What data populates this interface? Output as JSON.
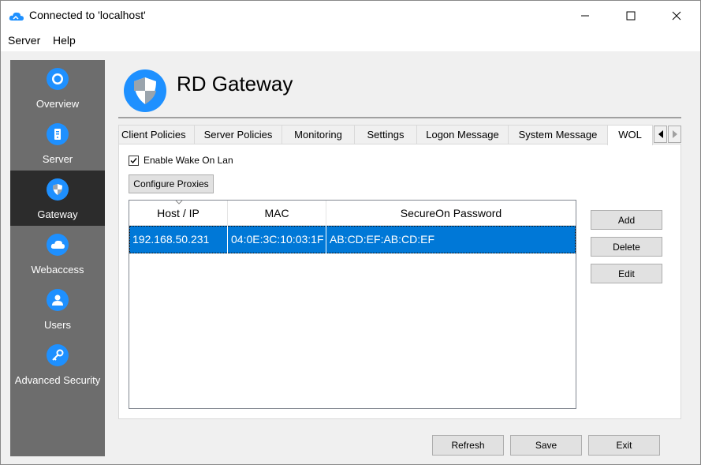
{
  "window": {
    "title": "Connected to 'localhost'"
  },
  "menu": [
    "Server",
    "Help"
  ],
  "sidebar": {
    "items": [
      {
        "label": "Overview",
        "icon": "overview-icon",
        "active": false
      },
      {
        "label": "Server",
        "icon": "server-icon",
        "active": false
      },
      {
        "label": "Gateway",
        "icon": "shield-icon",
        "active": true
      },
      {
        "label": "Webaccess",
        "icon": "cloud-icon",
        "active": false
      },
      {
        "label": "Users",
        "icon": "users-icon",
        "active": false
      },
      {
        "label": "Advanced Security",
        "icon": "key-icon",
        "active": false
      }
    ]
  },
  "header": {
    "title": "RD Gateway",
    "icon": "shield-icon"
  },
  "tabs": [
    {
      "label": "Client Policies"
    },
    {
      "label": "Server Policies"
    },
    {
      "label": "Monitoring"
    },
    {
      "label": "Settings"
    },
    {
      "label": "Logon Message"
    },
    {
      "label": "System Message"
    },
    {
      "label": "WOL",
      "active": true
    }
  ],
  "wol": {
    "enable_label": "Enable Wake On Lan",
    "enable_checked": true,
    "configure_proxies": "Configure Proxies",
    "columns": [
      "Host / IP",
      "MAC",
      "SecureOn Password"
    ],
    "rows": [
      {
        "host": "192.168.50.231",
        "mac": "04:0E:3C:10:03:1F",
        "password": "AB:CD:EF:AB:CD:EF"
      }
    ],
    "add": "Add",
    "delete": "Delete",
    "edit": "Edit"
  },
  "footer": {
    "refresh": "Refresh",
    "save": "Save",
    "exit": "Exit"
  },
  "colors": {
    "accent": "#1e90ff",
    "selection": "#0078d7",
    "sidebar": "#6d6d6d",
    "sidebar_active": "#2c2c2c"
  }
}
